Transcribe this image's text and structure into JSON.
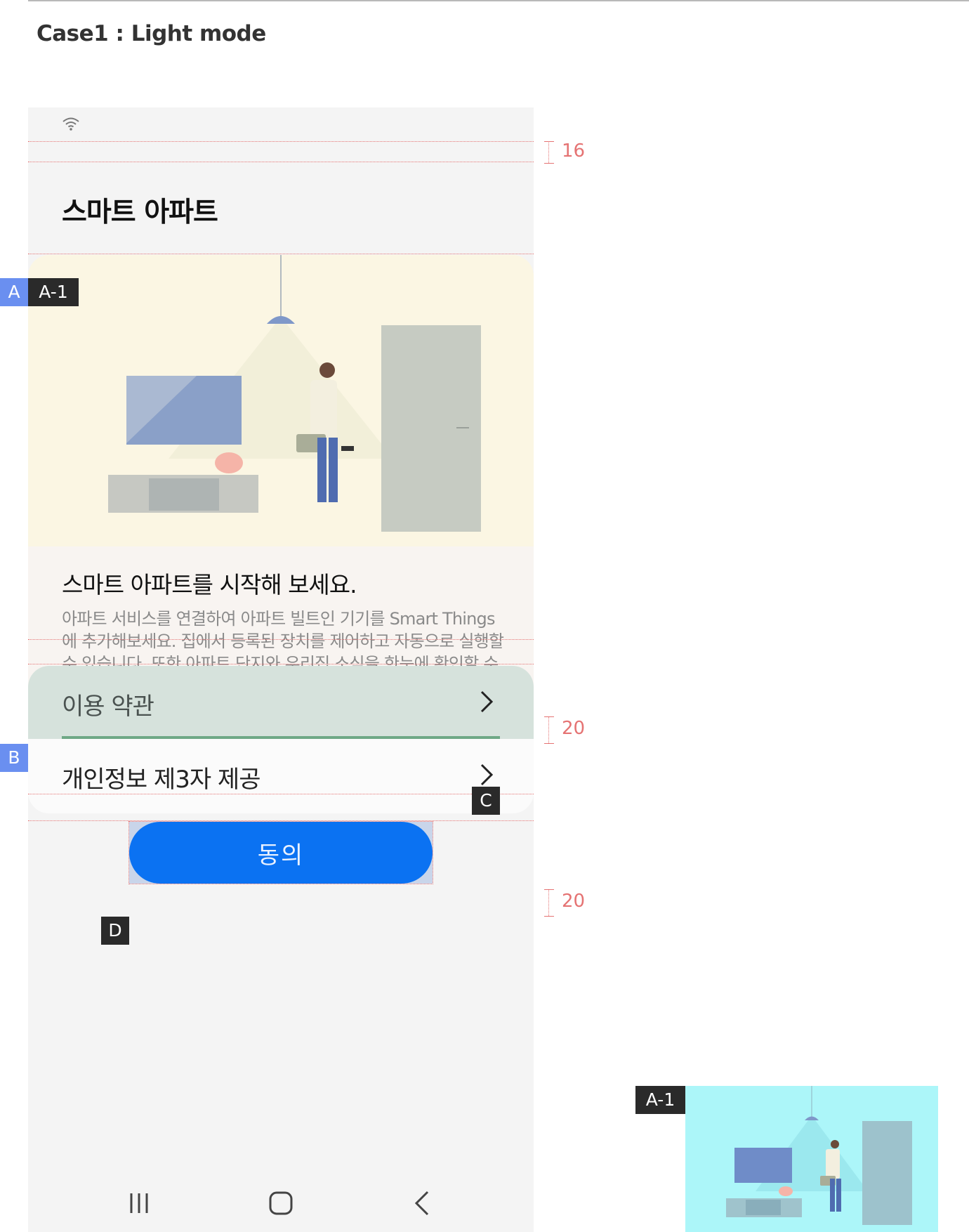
{
  "header": {
    "case_title": "Case1 : Light mode"
  },
  "app": {
    "title": "스마트 아파트",
    "card": {
      "headline": "스마트 아파트를 시작해 보세요.",
      "description": "아파트 서비스를 연결하여 아파트 빌트인 기기를 Smart Things에 추가해보세요. 집에서 등록된 장치를 제어하고 자동으로 실행할 수 있습니다. 또한 아파트 단지와 우리집 소식을 한눈에 확인할 수 있습니다."
    },
    "list": [
      {
        "label": "이용 약관"
      },
      {
        "label": "개인정보 제3자 제공"
      }
    ],
    "agree_button": "동의"
  },
  "annotations": {
    "a": "A",
    "a1": "A-1",
    "b": "B",
    "c": "C",
    "d": "D",
    "gap_top": "16",
    "gap_middle": "20",
    "gap_bottom": "20",
    "preview_label": "A-1"
  },
  "icons": [
    "wifi-icon",
    "chevron-right-icon",
    "recent-apps-icon",
    "home-icon",
    "back-icon"
  ],
  "colors": {
    "primary_button": "#0b72f2",
    "focus_row": "#d6e2dc",
    "focus_underline": "#6fa886",
    "illustration_bg": "#fbf6e3",
    "annotation_blue": "#6a8ff0",
    "annotation_dark": "#2a2a2a",
    "measure_red": "#e57373",
    "preview_bg": "#acf6f9"
  }
}
